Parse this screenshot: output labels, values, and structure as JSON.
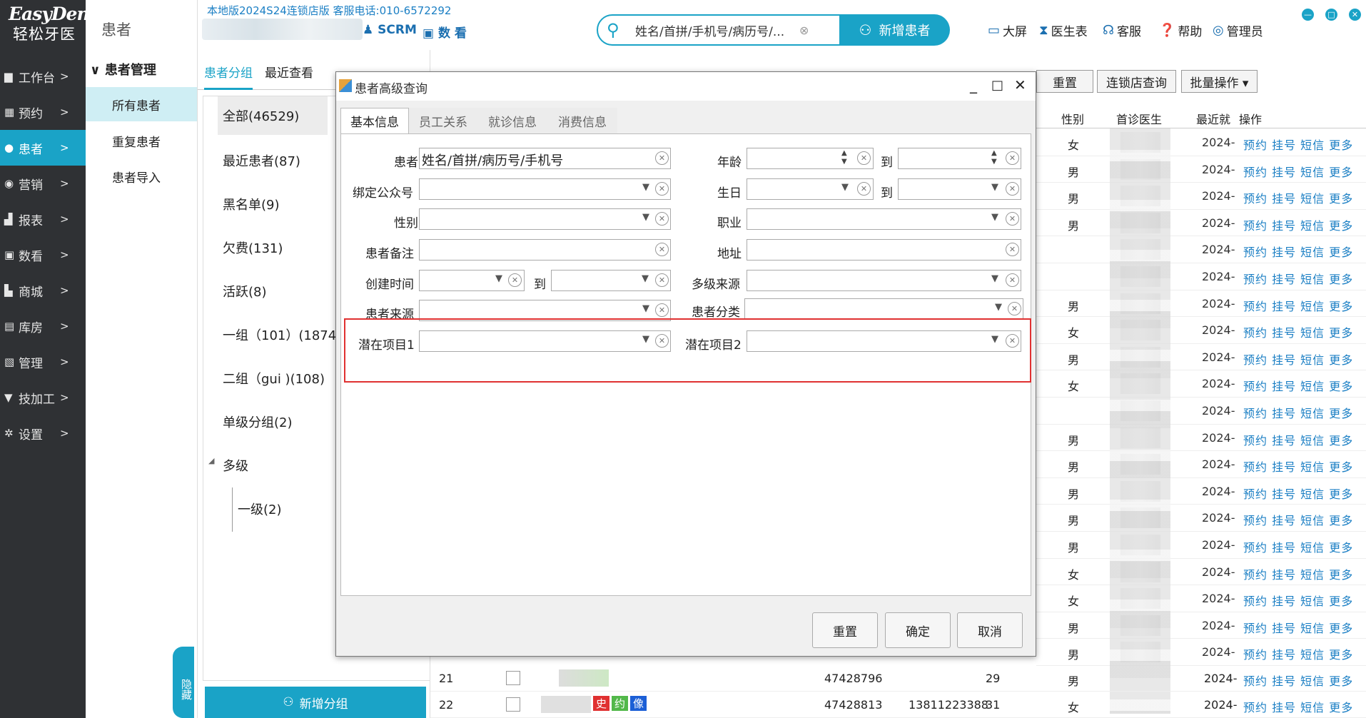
{
  "logo": {
    "en": "EasyDent",
    "cn": "轻松牙医"
  },
  "sidebar": {
    "items": [
      {
        "icon": "desktop-icon",
        "glyph": "▆",
        "label": "工作台",
        "arrow": ">"
      },
      {
        "icon": "calendar-icon",
        "glyph": "▦",
        "label": "预约",
        "arrow": ">"
      },
      {
        "icon": "user-icon",
        "glyph": "●",
        "label": "患者",
        "arrow": ">"
      },
      {
        "icon": "marketing-icon",
        "glyph": "◉",
        "label": "营销",
        "arrow": ">"
      },
      {
        "icon": "report-icon",
        "glyph": "▟",
        "label": "报表",
        "arrow": ">"
      },
      {
        "icon": "data-view-icon",
        "glyph": "▣",
        "label": "数看",
        "arrow": ">"
      },
      {
        "icon": "cart-icon",
        "glyph": "▙",
        "label": "商城",
        "arrow": ">"
      },
      {
        "icon": "warehouse-icon",
        "glyph": "▤",
        "label": "库房",
        "arrow": ">"
      },
      {
        "icon": "manage-icon",
        "glyph": "▧",
        "label": "管理",
        "arrow": ">"
      },
      {
        "icon": "tooth-icon",
        "glyph": "▼",
        "label": "技加工",
        "arrow": ">"
      },
      {
        "icon": "gear-icon",
        "glyph": "✲",
        "label": "设置",
        "arrow": ">"
      }
    ]
  },
  "col2": {
    "title": "患者",
    "group": "∨ 患者管理",
    "items": [
      "所有患者",
      "重复患者",
      "患者导入"
    ]
  },
  "header": {
    "version": "本地版2024S24连锁店版 客服电话:010-6572292",
    "scrm": "SCRM",
    "shukan": "数 看",
    "search_value": "姓名/首拼/手机号/病历号/...",
    "new_patient": "新增患者",
    "links": [
      "大屏",
      "医生表",
      "客服",
      "帮助",
      "管理员"
    ]
  },
  "groups": {
    "tabs": [
      "患者分组",
      "最近查看"
    ],
    "items": [
      "全部(46529)",
      "最近患者(87)",
      "黑名单(9)",
      "欠费(131)",
      "活跃(8)",
      "一组（101）(1874",
      "二组（gui )(108)",
      "单级分组(2)",
      "多级",
      "一级(2)"
    ],
    "add_button": "新增分组",
    "hide": "隐藏"
  },
  "table": {
    "buttons": [
      "重置",
      "连锁店查询",
      "批量操作 ▾"
    ],
    "headers": [
      "性别",
      "首诊医生",
      "最近就",
      "操作"
    ],
    "genders": [
      "女",
      "男",
      "男",
      "男",
      "",
      "",
      "男",
      "女",
      "男",
      "女",
      "",
      "男",
      "男",
      "男",
      "男",
      "男",
      "女",
      "女",
      "男",
      "男"
    ],
    "date": "2024-",
    "ops": "预约 挂号 短信 更多",
    "bottom_rows": [
      {
        "no": "21",
        "id": "47428796",
        "phone": "",
        "age": "29",
        "gender": "男",
        "date": "2024-",
        "ops": "预约 挂号 短信 更多"
      },
      {
        "no": "22",
        "id": "47428813",
        "phone": "13811223388",
        "age": "31",
        "gender": "女",
        "date": "2024-",
        "ops": "预约 挂号 短信 更多"
      }
    ],
    "tags": [
      "史",
      "约",
      "像"
    ]
  },
  "dialog": {
    "title": "患者高级查询",
    "tabs": [
      "基本信息",
      "员工关系",
      "就诊信息",
      "消费信息"
    ],
    "labels": {
      "patient": "患者",
      "bind_wechat": "绑定公众号",
      "gender": "性别",
      "remark": "患者备注",
      "create_time": "创建时间",
      "source": "患者来源",
      "potential1": "潜在项目1",
      "age": "年龄",
      "birthday": "生日",
      "job": "职业",
      "address": "地址",
      "multi_source": "多级来源",
      "category": "患者分类",
      "potential2": "潜在项目2",
      "to": "到"
    },
    "patient_value": "姓名/首拼/病历号/手机号",
    "buttons": {
      "reset": "重置",
      "ok": "确定",
      "cancel": "取消"
    }
  }
}
